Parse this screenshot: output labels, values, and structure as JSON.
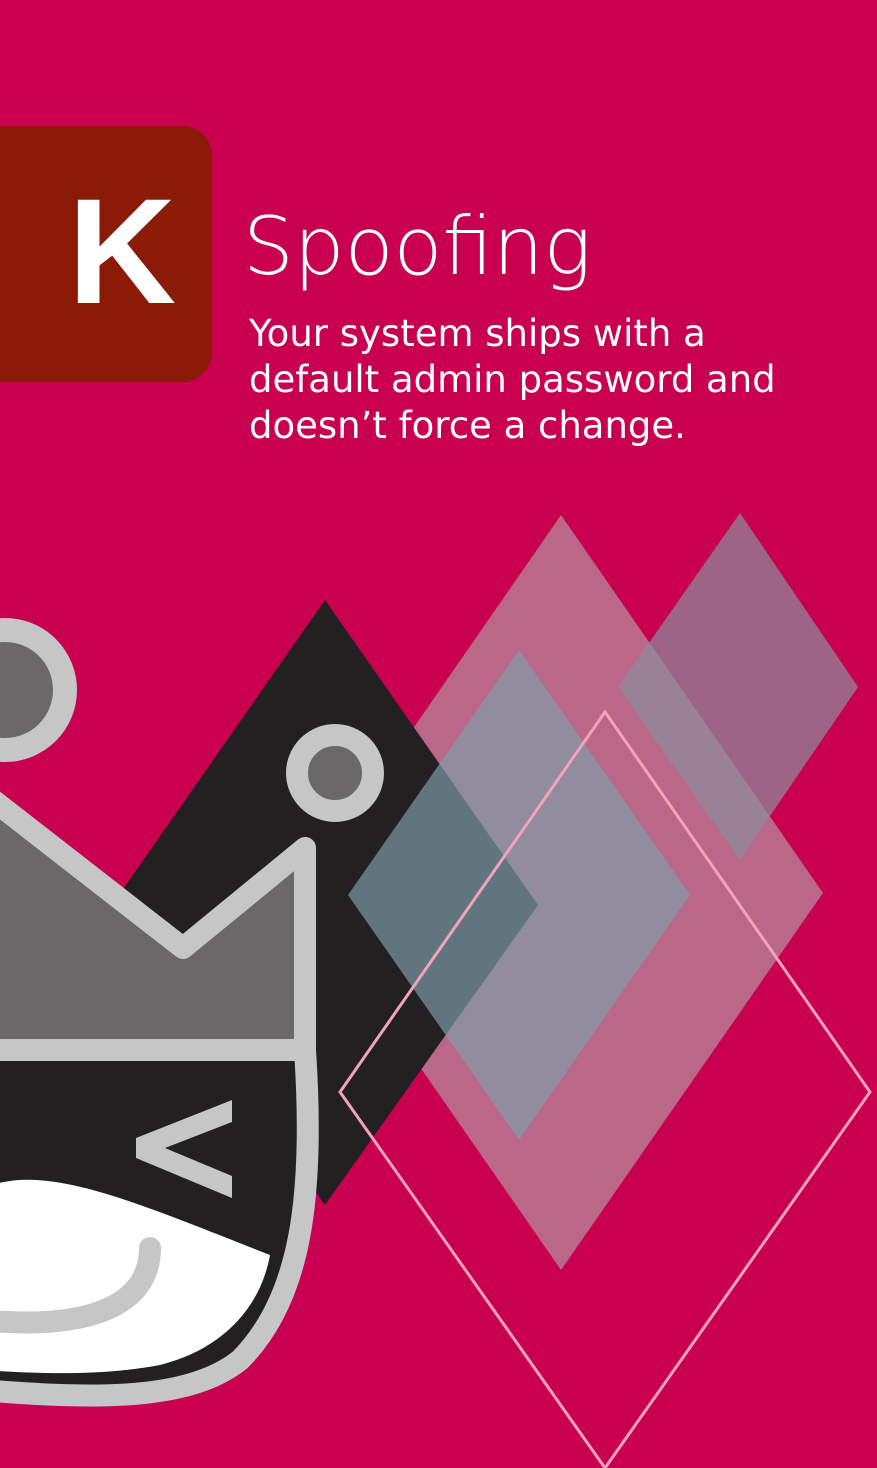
{
  "card": {
    "rank": "K",
    "suit": "Spoofing",
    "threat": "Your system ships with a default admin password and doesn’t force a change."
  },
  "colors": {
    "background": "#c8004f",
    "rank_tab": "#8b1b06",
    "text": "#ffffff"
  },
  "illustration": {
    "elements": [
      "mascot-character",
      "black-diamond",
      "translucent-diamonds",
      "outline-diamond"
    ]
  }
}
